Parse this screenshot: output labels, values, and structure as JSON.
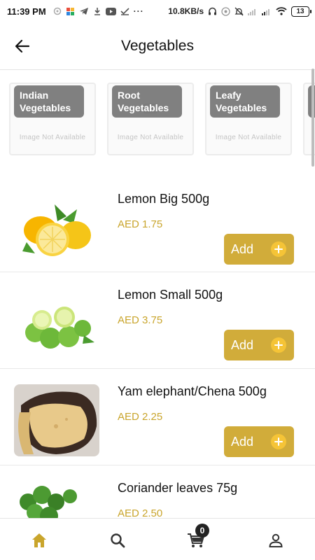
{
  "status_bar": {
    "time": "11:39 PM",
    "network_speed": "10.8KB/s",
    "battery": "13",
    "icons": [
      "settings-icon",
      "photos-icon",
      "telegram-icon",
      "download-icon",
      "youtube-icon",
      "check-icon",
      "more-dots-icon",
      "headset-icon",
      "hotspot-icon",
      "mute-icon",
      "signal-icon",
      "signal-icon",
      "wifi-icon",
      "battery-icon"
    ]
  },
  "header": {
    "title": "Vegetables",
    "back_icon": "arrow-left-icon"
  },
  "categories": [
    {
      "label": "Indian Vegetables",
      "placeholder": "Image Not Available"
    },
    {
      "label": "Root Vegetables",
      "placeholder": "Image Not Available"
    },
    {
      "label": "Leafy Vegetables",
      "placeholder": "Image Not Available"
    }
  ],
  "products": [
    {
      "name": "Lemon Big 500g",
      "price": "AED 1.75",
      "add_label": "Add"
    },
    {
      "name": "Lemon Small 500g",
      "price": "AED 3.75",
      "add_label": "Add"
    },
    {
      "name": "Yam elephant/Chena 500g",
      "price": "AED 2.25",
      "add_label": "Add"
    },
    {
      "name": "Coriander leaves 75g",
      "price": "AED 2.50",
      "add_label": "Add"
    }
  ],
  "bottom_nav": {
    "cart_count": "0",
    "items": [
      "home-icon",
      "search-icon",
      "cart-icon",
      "profile-icon"
    ]
  },
  "colors": {
    "accent": "#d1ac3a",
    "price": "#c9a52c",
    "plus_circle": "#f5c437"
  }
}
